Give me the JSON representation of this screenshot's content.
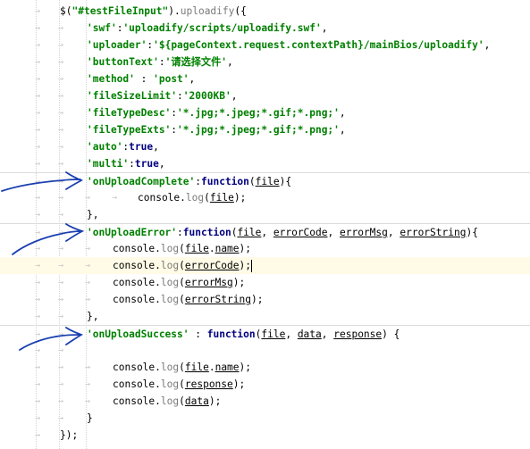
{
  "editor": {
    "colors": {
      "string": "#008000",
      "keyword": "#000080",
      "method": "#7a7a7a",
      "highlight": "#fffbe6",
      "annotation": "#1a3fb0"
    },
    "lines": [
      {
        "indent": 0,
        "tabs": 1,
        "tokens": [
          {
            "t": "plain",
            "v": "$("
          },
          {
            "t": "str",
            "v": "\"#testFileInput\""
          },
          {
            "t": "plain",
            "v": ")."
          },
          {
            "t": "fn",
            "v": "uploadify"
          },
          {
            "t": "plain",
            "v": "({"
          }
        ]
      },
      {
        "indent": 1,
        "tabs": 2,
        "tokens": [
          {
            "t": "str",
            "v": "'swf'"
          },
          {
            "t": "plain",
            "v": ":"
          },
          {
            "t": "str",
            "v": "'uploadify/scripts/uploadify.swf'"
          },
          {
            "t": "plain",
            "v": ","
          }
        ]
      },
      {
        "indent": 1,
        "tabs": 2,
        "tokens": [
          {
            "t": "str",
            "v": "'uploader'"
          },
          {
            "t": "plain",
            "v": ":"
          },
          {
            "t": "str",
            "v": "'${pageContext.request.contextPath}/mainBios/uploadify'"
          },
          {
            "t": "plain",
            "v": ","
          }
        ]
      },
      {
        "indent": 1,
        "tabs": 2,
        "tokens": [
          {
            "t": "str",
            "v": "'buttonText'"
          },
          {
            "t": "plain",
            "v": ":"
          },
          {
            "t": "str",
            "v": "'请选择文件'"
          },
          {
            "t": "plain",
            "v": ","
          }
        ]
      },
      {
        "indent": 1,
        "tabs": 2,
        "tokens": [
          {
            "t": "str",
            "v": "'method'"
          },
          {
            "t": "plain",
            "v": " : "
          },
          {
            "t": "str",
            "v": "'post'"
          },
          {
            "t": "plain",
            "v": ","
          }
        ]
      },
      {
        "indent": 1,
        "tabs": 2,
        "tokens": [
          {
            "t": "str",
            "v": "'fileSizeLimit'"
          },
          {
            "t": "plain",
            "v": ":"
          },
          {
            "t": "str",
            "v": "'2000KB'"
          },
          {
            "t": "plain",
            "v": ","
          }
        ]
      },
      {
        "indent": 1,
        "tabs": 2,
        "tokens": [
          {
            "t": "str",
            "v": "'fileTypeDesc'"
          },
          {
            "t": "plain",
            "v": ":"
          },
          {
            "t": "str",
            "v": "'*.jpg;*.jpeg;*.gif;*.png;'"
          },
          {
            "t": "plain",
            "v": ","
          }
        ]
      },
      {
        "indent": 1,
        "tabs": 2,
        "tokens": [
          {
            "t": "str",
            "v": "'fileTypeExts'"
          },
          {
            "t": "plain",
            "v": ":"
          },
          {
            "t": "str",
            "v": "'*.jpg;*.jpeg;*.gif;*.png;'"
          },
          {
            "t": "plain",
            "v": ","
          }
        ]
      },
      {
        "indent": 1,
        "tabs": 2,
        "tokens": [
          {
            "t": "str",
            "v": "'auto'"
          },
          {
            "t": "plain",
            "v": ":"
          },
          {
            "t": "kw",
            "v": "true"
          },
          {
            "t": "plain",
            "v": ","
          }
        ]
      },
      {
        "indent": 1,
        "tabs": 2,
        "tokens": [
          {
            "t": "str",
            "v": "'multi'"
          },
          {
            "t": "plain",
            "v": ":"
          },
          {
            "t": "kw",
            "v": "true"
          },
          {
            "t": "plain",
            "v": ","
          }
        ]
      },
      {
        "indent": 1,
        "tabs": 2,
        "sep": true,
        "tokens": [
          {
            "t": "str",
            "v": "'onUploadComplete'"
          },
          {
            "t": "plain",
            "v": ":"
          },
          {
            "t": "kw",
            "v": "function"
          },
          {
            "t": "plain",
            "v": "("
          },
          {
            "t": "ref",
            "v": "file"
          },
          {
            "t": "plain",
            "v": "){"
          }
        ]
      },
      {
        "indent": 3,
        "tabs": 4,
        "tokens": [
          {
            "t": "id",
            "v": "console"
          },
          {
            "t": "plain",
            "v": "."
          },
          {
            "t": "fn",
            "v": "log"
          },
          {
            "t": "plain",
            "v": "("
          },
          {
            "t": "ref",
            "v": "file"
          },
          {
            "t": "plain",
            "v": ");"
          }
        ]
      },
      {
        "indent": 1,
        "tabs": 2,
        "tokens": [
          {
            "t": "plain",
            "v": "},"
          }
        ]
      },
      {
        "indent": 1,
        "tabs": 2,
        "sep": true,
        "tokens": [
          {
            "t": "str",
            "v": "'onUploadError'"
          },
          {
            "t": "plain",
            "v": ":"
          },
          {
            "t": "kw",
            "v": "function"
          },
          {
            "t": "plain",
            "v": "("
          },
          {
            "t": "ref",
            "v": "file"
          },
          {
            "t": "plain",
            "v": ", "
          },
          {
            "t": "ref",
            "v": "errorCode"
          },
          {
            "t": "plain",
            "v": ", "
          },
          {
            "t": "ref",
            "v": "errorMsg"
          },
          {
            "t": "plain",
            "v": ", "
          },
          {
            "t": "ref",
            "v": "errorString"
          },
          {
            "t": "plain",
            "v": "){"
          }
        ]
      },
      {
        "indent": 2,
        "tabs": 3,
        "tokens": [
          {
            "t": "id",
            "v": "console"
          },
          {
            "t": "plain",
            "v": "."
          },
          {
            "t": "fn",
            "v": "log"
          },
          {
            "t": "plain",
            "v": "("
          },
          {
            "t": "ref",
            "v": "file"
          },
          {
            "t": "plain",
            "v": "."
          },
          {
            "t": "ref",
            "v": "name"
          },
          {
            "t": "plain",
            "v": ");"
          }
        ]
      },
      {
        "indent": 2,
        "tabs": 3,
        "highlight": true,
        "caret": true,
        "tokens": [
          {
            "t": "id",
            "v": "console"
          },
          {
            "t": "plain",
            "v": "."
          },
          {
            "t": "fn",
            "v": "log"
          },
          {
            "t": "plain",
            "v": "("
          },
          {
            "t": "ref",
            "v": "errorCode"
          },
          {
            "t": "plain",
            "v": ");"
          }
        ]
      },
      {
        "indent": 2,
        "tabs": 3,
        "tokens": [
          {
            "t": "id",
            "v": "console"
          },
          {
            "t": "plain",
            "v": "."
          },
          {
            "t": "fn",
            "v": "log"
          },
          {
            "t": "plain",
            "v": "("
          },
          {
            "t": "ref",
            "v": "errorMsg"
          },
          {
            "t": "plain",
            "v": ");"
          }
        ]
      },
      {
        "indent": 2,
        "tabs": 3,
        "tokens": [
          {
            "t": "id",
            "v": "console"
          },
          {
            "t": "plain",
            "v": "."
          },
          {
            "t": "fn",
            "v": "log"
          },
          {
            "t": "plain",
            "v": "("
          },
          {
            "t": "ref",
            "v": "errorString"
          },
          {
            "t": "plain",
            "v": ");"
          }
        ]
      },
      {
        "indent": 1,
        "tabs": 2,
        "tokens": [
          {
            "t": "plain",
            "v": "},"
          }
        ]
      },
      {
        "indent": 1,
        "tabs": 2,
        "sep": true,
        "tokens": [
          {
            "t": "str",
            "v": "'onUploadSuccess'"
          },
          {
            "t": "plain",
            "v": " : "
          },
          {
            "t": "kw",
            "v": "function"
          },
          {
            "t": "plain",
            "v": "("
          },
          {
            "t": "ref",
            "v": "file"
          },
          {
            "t": "plain",
            "v": ", "
          },
          {
            "t": "ref",
            "v": "data"
          },
          {
            "t": "plain",
            "v": ", "
          },
          {
            "t": "ref",
            "v": "response"
          },
          {
            "t": "plain",
            "v": ") {"
          }
        ]
      },
      {
        "indent": 1,
        "tabs": 2,
        "tokens": []
      },
      {
        "indent": 2,
        "tabs": 3,
        "tokens": [
          {
            "t": "id",
            "v": "console"
          },
          {
            "t": "plain",
            "v": "."
          },
          {
            "t": "fn",
            "v": "log"
          },
          {
            "t": "plain",
            "v": "("
          },
          {
            "t": "ref",
            "v": "file"
          },
          {
            "t": "plain",
            "v": "."
          },
          {
            "t": "ref",
            "v": "name"
          },
          {
            "t": "plain",
            "v": ");"
          }
        ]
      },
      {
        "indent": 2,
        "tabs": 3,
        "tokens": [
          {
            "t": "id",
            "v": "console"
          },
          {
            "t": "plain",
            "v": "."
          },
          {
            "t": "fn",
            "v": "log"
          },
          {
            "t": "plain",
            "v": "("
          },
          {
            "t": "ref",
            "v": "response"
          },
          {
            "t": "plain",
            "v": ");"
          }
        ]
      },
      {
        "indent": 2,
        "tabs": 3,
        "tokens": [
          {
            "t": "id",
            "v": "console"
          },
          {
            "t": "plain",
            "v": "."
          },
          {
            "t": "fn",
            "v": "log"
          },
          {
            "t": "plain",
            "v": "("
          },
          {
            "t": "ref",
            "v": "data"
          },
          {
            "t": "plain",
            "v": ");"
          }
        ]
      },
      {
        "indent": 1,
        "tabs": 2,
        "tokens": [
          {
            "t": "plain",
            "v": "}"
          }
        ]
      },
      {
        "indent": 0,
        "tabs": 1,
        "tokens": [
          {
            "t": "plain",
            "v": "});"
          }
        ]
      }
    ]
  }
}
